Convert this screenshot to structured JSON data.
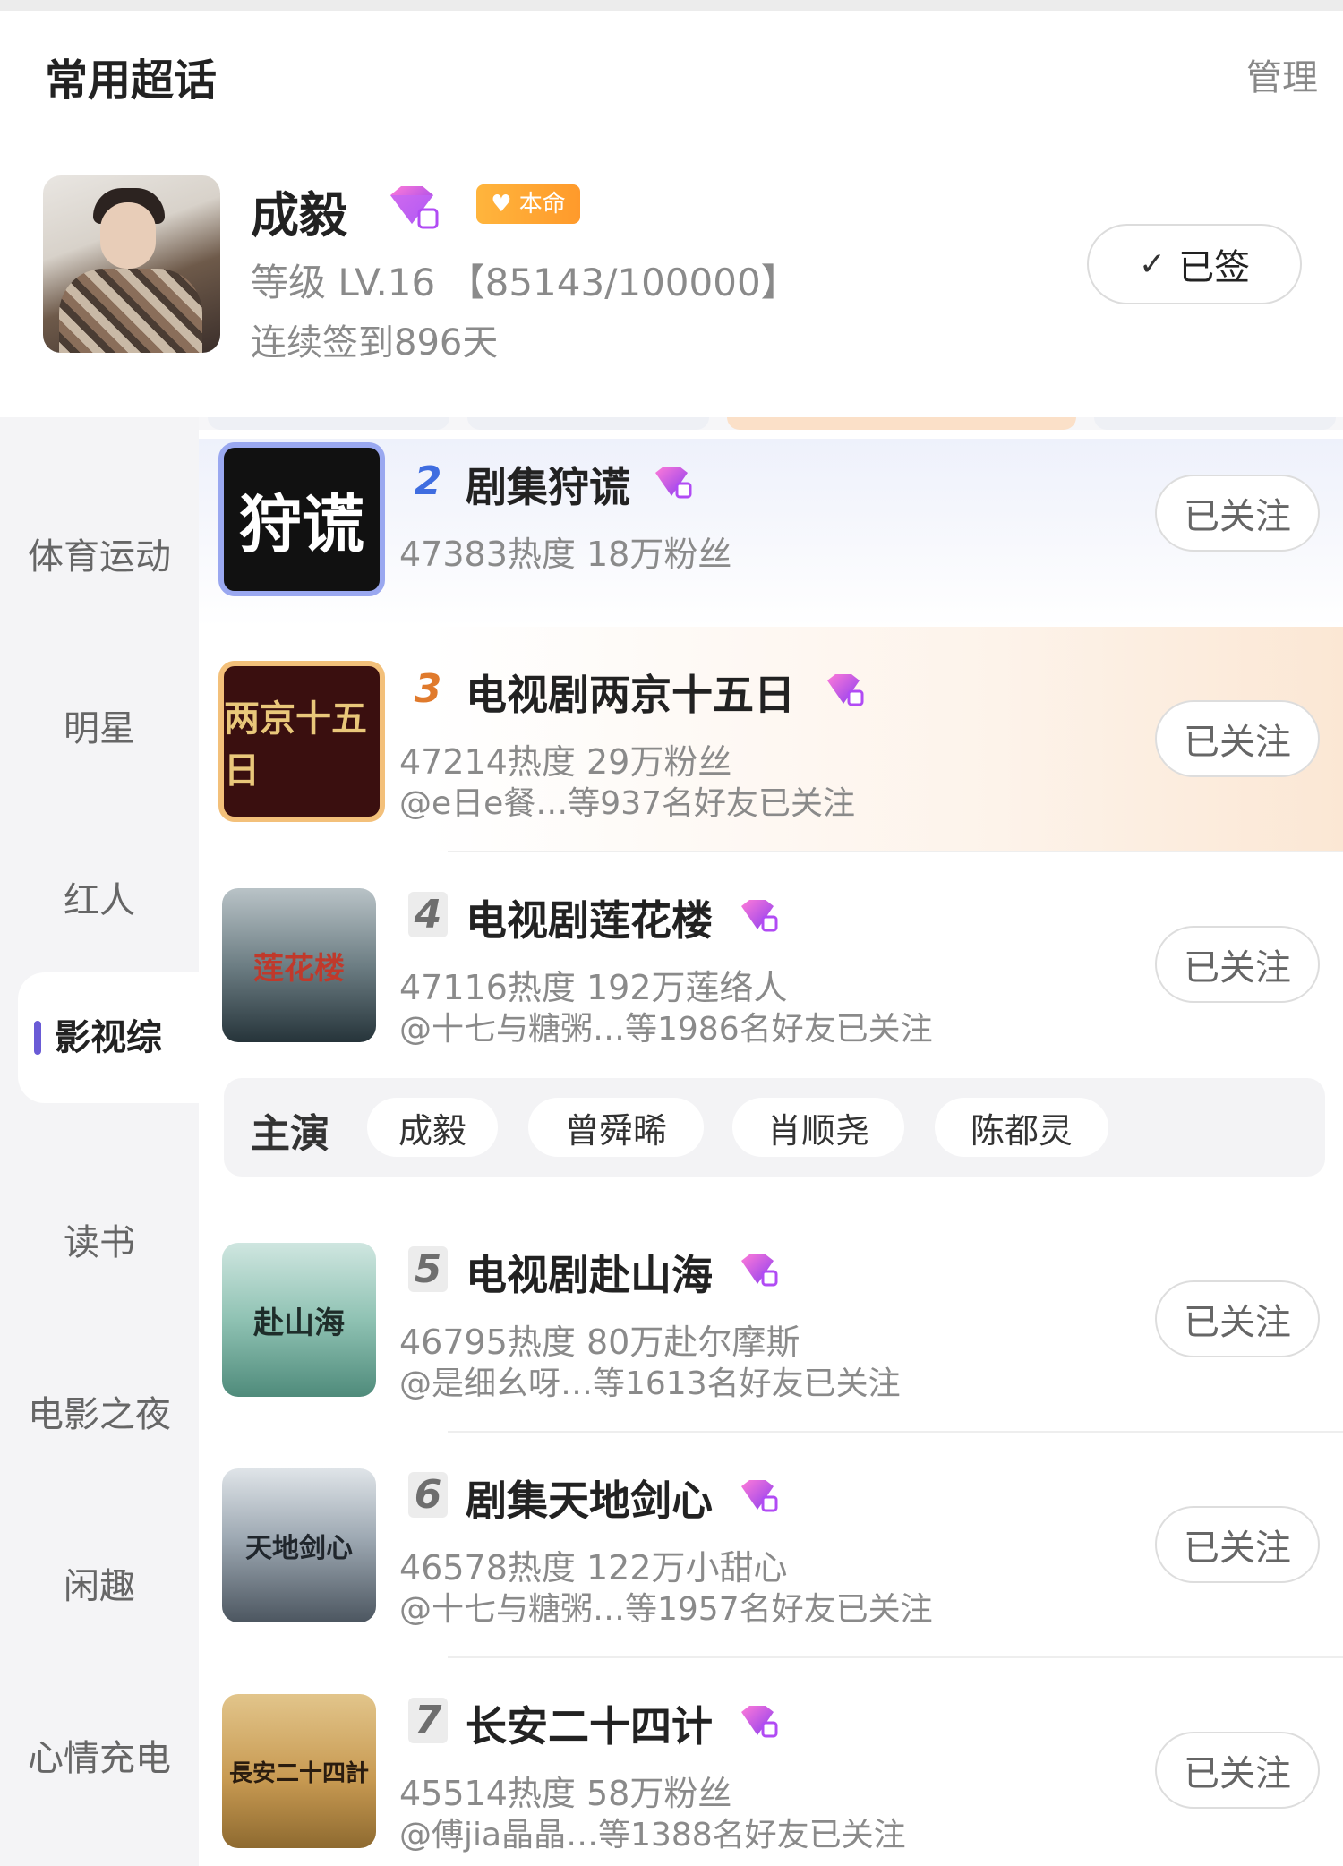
{
  "header": {
    "title": "常用超话",
    "manage_label": "管理"
  },
  "favorite": {
    "name": "成毅",
    "badge": "本命",
    "level": "等级 LV.16 【85143/100000】",
    "streak": "连续签到896天",
    "signed_label": "已签",
    "check_glyph": "✓"
  },
  "sidebar": {
    "items": [
      {
        "label": "体育运动"
      },
      {
        "label": "明星"
      },
      {
        "label": "红人"
      },
      {
        "label": "影视综"
      },
      {
        "label": "读书"
      },
      {
        "label": "电影之夜"
      },
      {
        "label": "闲趣"
      },
      {
        "label": "心情充电"
      }
    ]
  },
  "list": [
    {
      "rank": "2",
      "title": "剧集狩谎",
      "stats": "47383热度 18万粉丝",
      "friends": "",
      "follow": "已关注",
      "cover": "狩谎"
    },
    {
      "rank": "3",
      "title": "电视剧两京十五日",
      "stats": "47214热度 29万粉丝",
      "friends": "@e日e餐…等937名好友已关注",
      "follow": "已关注",
      "cover": "两京十五日"
    },
    {
      "rank": "4",
      "title": "电视剧莲花楼",
      "stats": "47116热度 192万莲络人",
      "friends": "@十七与糖粥…等1986名好友已关注",
      "follow": "已关注",
      "cover": "莲花楼"
    },
    {
      "rank": "5",
      "title": "电视剧赴山海",
      "stats": "46795热度 80万赴尔摩斯",
      "friends": "@是细幺呀…等1613名好友已关注",
      "follow": "已关注",
      "cover": "赴山海"
    },
    {
      "rank": "6",
      "title": "剧集天地剑心",
      "stats": "46578热度 122万小甜心",
      "friends": "@十七与糖粥…等1957名好友已关注",
      "follow": "已关注",
      "cover": "天地剑心"
    },
    {
      "rank": "7",
      "title": "长安二十四计",
      "stats": "45514热度 58万粉丝",
      "friends": "@傅jia晶晶…等1388名好友已关注",
      "follow": "已关注",
      "cover": "長安二十四計"
    }
  ],
  "cast": {
    "label": "主演",
    "members": [
      "成毅",
      "曾舜晞",
      "肖顺尧",
      "陈都灵"
    ]
  },
  "colors": {
    "accent": "#6a5bd6",
    "gem": "#b14bf4",
    "badge": "#ff9a2b",
    "rank_blue": "#3f6de0",
    "rank_orange": "#e07a2c"
  }
}
